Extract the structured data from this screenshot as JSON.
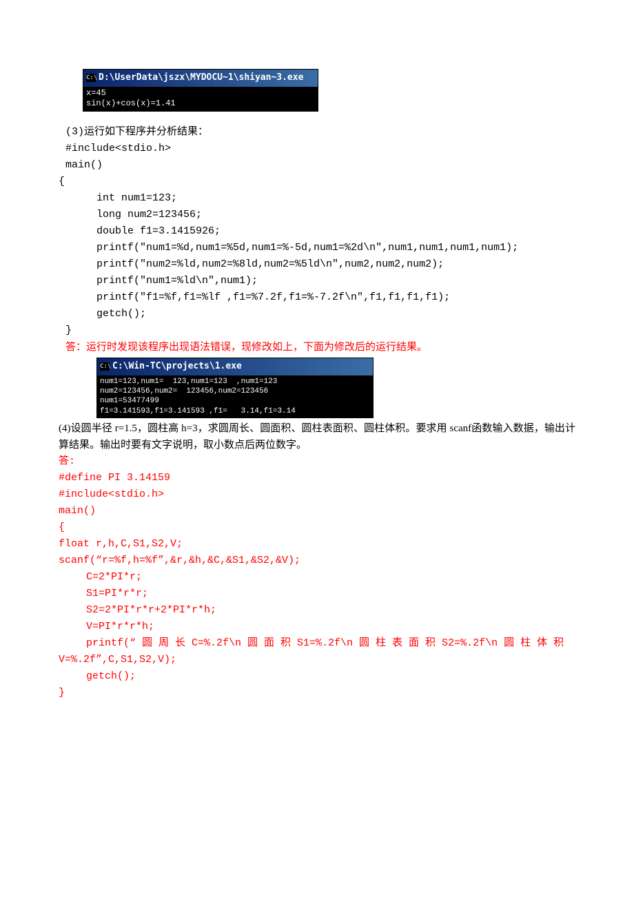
{
  "console1": {
    "title": "D:\\UserData\\jszx\\MYDOCU~1\\shiyan~3.exe",
    "body": "x=45\nsin(x)+cos(x)=1.41"
  },
  "section3": {
    "title": "(3)运行如下程序并分析结果：",
    "code": {
      "l1": "#include<stdio.h>",
      "l2": "main()",
      "l3": "{",
      "l4": "int  num1=123;",
      "l5": "long  num2=123456;",
      "l6": "double f1=3.1415926;",
      "l7": "printf(\"num1=%d,num1=%5d,num1=%-5d,num1=%2d\\n\",num1,num1,num1,num1);",
      "l8": "printf(\"num2=%ld,num2=%8ld,num2=%5ld\\n\",num2,num2,num2);",
      "l9": "printf(\"num1=%ld\\n\",num1);",
      "l10": "printf(\"f1=%f,f1=%lf ,f1=%7.2f,f1=%-7.2f\\n\",f1,f1,f1,f1);",
      "l11": "getch();",
      "l12": " }"
    },
    "answer": "答：运行时发现该程序出现语法错误，现修改如上，下面为修改后的运行结果。"
  },
  "console2": {
    "title": "C:\\Win-TC\\projects\\1.exe",
    "body": "num1=123,num1=  123,num1=123  ,num1=123\nnum2=123456,num2=  123456,num2=123456\nnum1=53477499\nf1=3.141593,f1=3.141593 ,f1=   3.14,f1=3.14"
  },
  "section4": {
    "title": "   (4)设圆半径 r=1.5，圆柱高 h=3，求圆周长、圆面积、圆柱表面积、圆柱体积。要求用 scanf函数输入数据，输出计算结果。输出时要有文字说明，取小数点后两位数字。",
    "ans_label": "答:",
    "code": {
      "l1": "#define PI 3.14159",
      "l2": "#include<stdio.h>",
      "l3": "main()",
      "l4": "{",
      "l5": "float r,h,C,S1,S2,V;",
      "l6": "scanf(“r=%f,h=%f”,&r,&h,&C,&S1,&S2,&V);",
      "l7": "C=2*PI*r;",
      "l8": "S1=PI*r*r;",
      "l9": "S2=2*PI*r*r+2*PI*r*h;",
      "l10": "V=PI*r*r*h;",
      "l11a": "printf(“ 圆 周 长 C=%.2f\\n 圆 面 积 S1=%.2f\\n 圆 柱 表 面 积 S2=%.2f\\n 圆 柱 体 积",
      "l11b": "V=%.2f”,C,S1,S2,V);",
      "l12": "getch();",
      "l13": "}"
    }
  }
}
